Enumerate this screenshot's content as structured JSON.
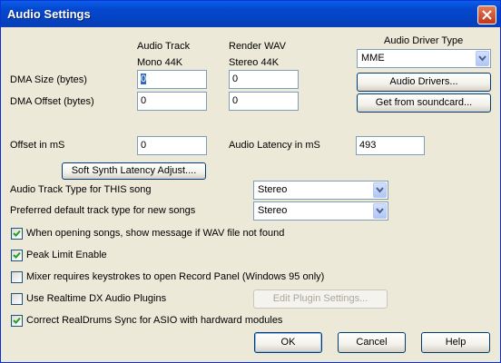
{
  "window": {
    "title": "Audio Settings"
  },
  "columns": {
    "track_title": "Audio Track",
    "track_sub": "Mono 44K",
    "wav_title": "Render WAV",
    "wav_sub": "Stereo 44K",
    "driver_type_label": "Audio Driver Type"
  },
  "rows": {
    "dma_size_label": "DMA Size (bytes)",
    "dma_offset_label": "DMA Offset (bytes)",
    "offset_ms_label": "Offset in mS",
    "latency_label": "Audio Latency in mS"
  },
  "values": {
    "dma_size_track": "0",
    "dma_size_wav": "0",
    "dma_offset_track": "0",
    "dma_offset_wav": "0",
    "offset_ms": "0",
    "latency_ms": "493"
  },
  "driver": {
    "selected": "MME",
    "drivers_button": "Audio Drivers...",
    "soundcard_button": "Get from soundcard..."
  },
  "soft_synth_button": "Soft Synth Latency Adjust....",
  "track_type": {
    "label": "Audio Track Type for THIS song",
    "selected": "Stereo"
  },
  "preferred_type": {
    "label": "Preferred default track type for new songs",
    "selected": "Stereo"
  },
  "checkboxes": [
    {
      "label": "When opening songs, show message if WAV file not found",
      "checked": true
    },
    {
      "label": "Peak Limit Enable",
      "checked": true
    },
    {
      "label": "Mixer requires keystrokes to open Record Panel (Windows 95 only)",
      "checked": false
    },
    {
      "label": "Use Realtime DX Audio Plugins",
      "checked": false
    },
    {
      "label": "Correct RealDrums Sync for ASIO with hardward modules",
      "checked": true
    }
  ],
  "edit_plugin_button": "Edit Plugin Settings...",
  "buttons": {
    "ok": "OK",
    "cancel": "Cancel",
    "help": "Help"
  }
}
